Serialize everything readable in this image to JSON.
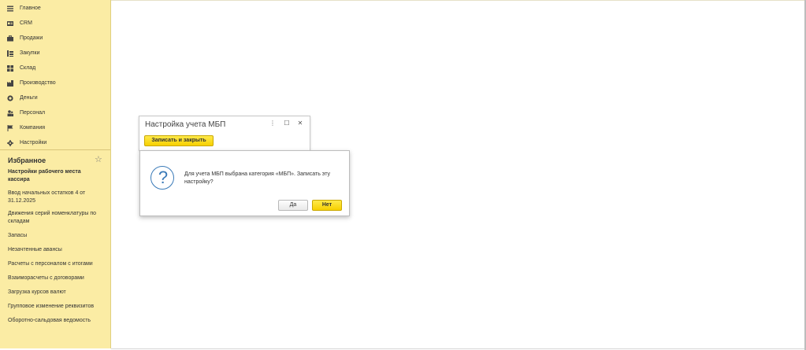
{
  "sidebar": {
    "items": [
      {
        "label": "Главное",
        "icon": "menu-lines-icon"
      },
      {
        "label": "CRM",
        "icon": "crm-card-icon"
      },
      {
        "label": "Продажи",
        "icon": "briefcase-icon"
      },
      {
        "label": "Закупки",
        "icon": "cart-icon"
      },
      {
        "label": "Склад",
        "icon": "warehouse-icon"
      },
      {
        "label": "Производство",
        "icon": "factory-icon"
      },
      {
        "label": "Деньги",
        "icon": "coins-icon"
      },
      {
        "label": "Персонал",
        "icon": "people-icon"
      },
      {
        "label": "Компания",
        "icon": "flag-icon"
      },
      {
        "label": "Настройки",
        "icon": "gear-icon"
      }
    ]
  },
  "favorites": {
    "title": "Избранное",
    "items": [
      "Настройки рабочего места кассира",
      "Ввод начальных остатков 4 от 31.12.2025",
      "Движения серий номенклатуры по складам",
      "Запасы",
      "Незачтенные авансы",
      "Расчеты с персоналом с итогами",
      "Взаиморасчеты с договорами",
      "Загрузка курсов валют",
      "Групповое изменение реквизитов",
      "Оборотно-сальдовая ведомость"
    ]
  },
  "form": {
    "title": "Настройка учета МБП",
    "more_glyph": "⋮",
    "maximize_glyph": "☐",
    "close_glyph": "✕",
    "save_close_label": "Записать и закрыть"
  },
  "dialog": {
    "message": "Для учета МБП выбрана категория «МБП». Записать эту настройку?",
    "question_glyph": "?",
    "yes_label": "Да",
    "no_label": "Нет"
  },
  "colors": {
    "sidebar_bg": "#fbeca4",
    "accent_yellow": "#f7d000",
    "icon_blue": "#3a7ab8"
  }
}
